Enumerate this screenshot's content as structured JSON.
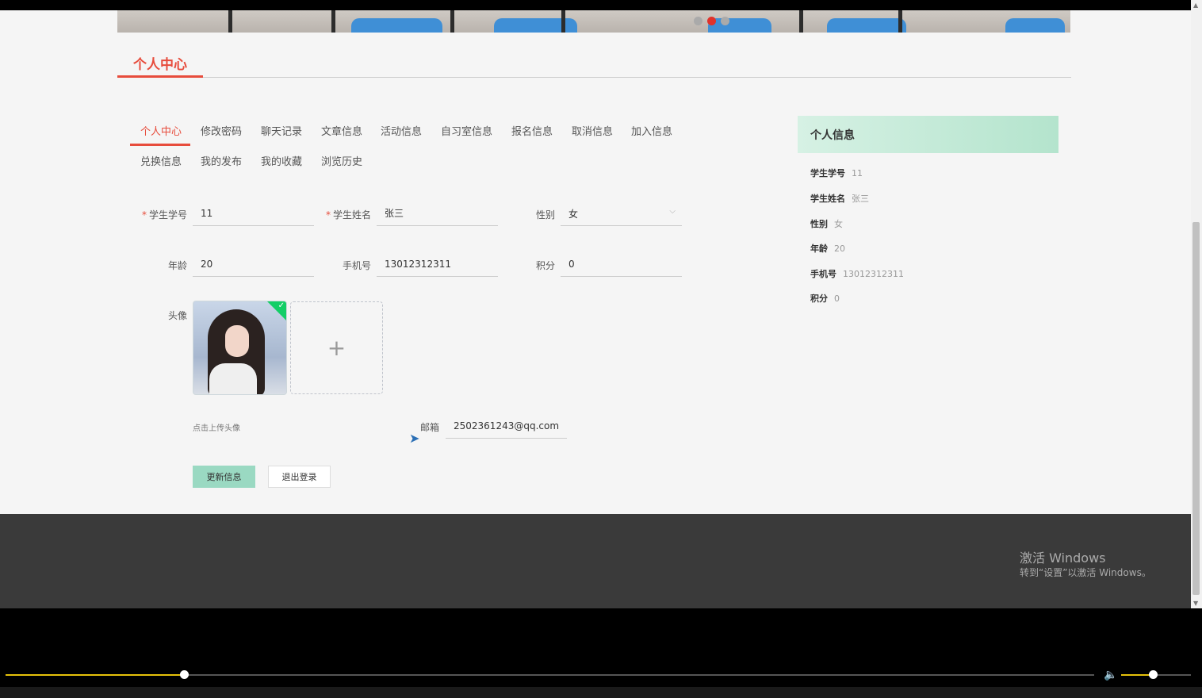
{
  "banner": {
    "dots": 3,
    "active_dot": 1
  },
  "section_title": "个人中心",
  "tabs": [
    {
      "label": "个人中心",
      "active": true
    },
    {
      "label": "修改密码"
    },
    {
      "label": "聊天记录"
    },
    {
      "label": "文章信息"
    },
    {
      "label": "活动信息"
    },
    {
      "label": "自习室信息"
    },
    {
      "label": "报名信息"
    },
    {
      "label": "取消信息"
    },
    {
      "label": "加入信息"
    },
    {
      "label": "兑换信息"
    },
    {
      "label": "我的发布"
    },
    {
      "label": "我的收藏"
    },
    {
      "label": "浏览历史"
    }
  ],
  "form": {
    "student_id": {
      "label": "学生学号",
      "value": "11",
      "required": "*"
    },
    "student_name": {
      "label": "学生姓名",
      "value": "张三",
      "required": "*"
    },
    "gender": {
      "label": "性别",
      "value": "女"
    },
    "age": {
      "label": "年龄",
      "value": "20"
    },
    "phone": {
      "label": "手机号",
      "value": "13012312311"
    },
    "points": {
      "label": "积分",
      "value": "0"
    },
    "avatar": {
      "label": "头像",
      "hint": "点击上传头像",
      "plus": "+"
    },
    "email": {
      "label": "邮箱",
      "value": "2502361243@qq.com"
    }
  },
  "buttons": {
    "update": "更新信息",
    "logout": "退出登录"
  },
  "info_card": {
    "title": "个人信息",
    "rows": [
      {
        "key": "学生学号",
        "value": "11"
      },
      {
        "key": "学生姓名",
        "value": "张三"
      },
      {
        "key": "性别",
        "value": "女"
      },
      {
        "key": "年龄",
        "value": "20"
      },
      {
        "key": "手机号",
        "value": "13012312311"
      },
      {
        "key": "积分",
        "value": "0"
      }
    ]
  },
  "watermark": {
    "line1": "激活 Windows",
    "line2": "转到“设置”以激活 Windows。"
  },
  "player": {
    "progress": 0.164,
    "volume": 0.45
  },
  "colors": {
    "accent": "#e74c3c",
    "primary_button": "#9ad9c2",
    "card_header": "#b4e4cd",
    "footer": "#3a3a3a"
  }
}
